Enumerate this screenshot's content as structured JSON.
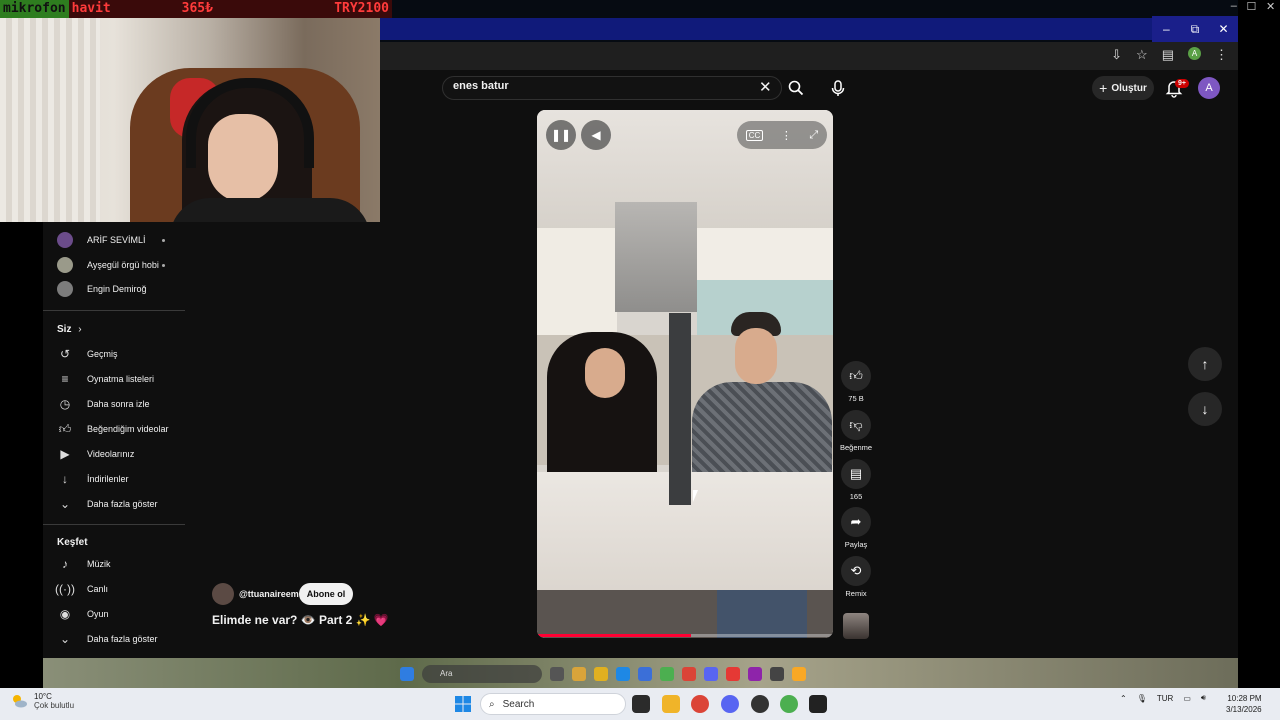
{
  "stream_overlay": {
    "mic": "mikrofon",
    "brand": "havit",
    "amount": "365₺",
    "currency": "TRY2100"
  },
  "search": {
    "query": "enes batur"
  },
  "header": {
    "create_label": "Oluştur",
    "notif_count": "9+",
    "avatar_letter": "A"
  },
  "sidebar": {
    "subscriptions": [
      {
        "label": "ARİF SEVİMLİ",
        "dot": true
      },
      {
        "label": "Ayşegül örgü hobi",
        "dot": true
      },
      {
        "label": "Engin Demiroğ",
        "dot": false
      }
    ],
    "you_heading": "Siz",
    "you_items": [
      {
        "label": "Geçmiş",
        "icon": "history-icon"
      },
      {
        "label": "Oynatma listeleri",
        "icon": "playlist-icon"
      },
      {
        "label": "Daha sonra izle",
        "icon": "clock-icon"
      },
      {
        "label": "Beğendiğim videolar",
        "icon": "thumb-up-icon"
      },
      {
        "label": "Videolarınız",
        "icon": "video-icon"
      },
      {
        "label": "İndirilenler",
        "icon": "download-icon"
      },
      {
        "label": "Daha fazla göster",
        "icon": "chevron-down-icon"
      }
    ],
    "explore_heading": "Keşfet",
    "explore_items": [
      {
        "label": "Müzik",
        "icon": "music-icon"
      },
      {
        "label": "Canlı",
        "icon": "live-icon"
      },
      {
        "label": "Oyun",
        "icon": "gaming-icon"
      },
      {
        "label": "Daha fazla göster",
        "icon": "chevron-down-icon"
      }
    ]
  },
  "video": {
    "channel": "@ttuanaireem",
    "subscribe_label": "Abone ol",
    "title": "Elimde ne var? 👁️ Part 2 ✨ 💗",
    "progress": 0.52
  },
  "actions": {
    "likes": "75 B",
    "dislike_label": "Beğenme",
    "comments": "165",
    "share_label": "Paylaş",
    "remix_label": "Remix"
  },
  "inner_taskbar": {
    "search_placeholder": "Ara"
  },
  "taskbar": {
    "weather_temp": "10°C",
    "weather_desc": "Çok bulutlu",
    "search_placeholder": "Search",
    "language": "TUR",
    "time": "10:28 PM",
    "date": "3/13/2026"
  }
}
